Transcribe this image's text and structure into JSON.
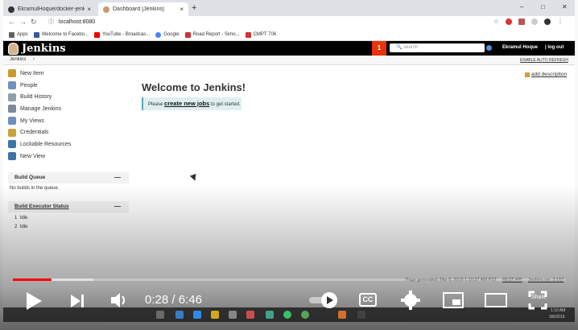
{
  "browser": {
    "tabs": [
      {
        "title": "EkramulHoque/docker-jenkins-..."
      },
      {
        "title": "Dashboard [Jenkins]"
      }
    ],
    "new_tab": "+",
    "url": "localhost:8080",
    "bookmarks": [
      "Apps",
      "Welcome to Facebo...",
      "YouTube - Broadcas...",
      "Google",
      "Road Report - Simo...",
      "CMPT 706"
    ]
  },
  "jenkins": {
    "logo": "Jenkins",
    "notification_count": "1",
    "search_placeholder": "search",
    "user": "Ekramul Hoque",
    "logout": "| log out",
    "breadcrumb": [
      "Jenkins",
      "›"
    ],
    "auto_refresh": "ENABLE AUTO REFRESH",
    "side_menu": [
      {
        "label": "New Item",
        "color": "#c89b2c"
      },
      {
        "label": "People",
        "color": "#6f8fbf"
      },
      {
        "label": "Build History",
        "color": "#8ea0a8"
      },
      {
        "label": "Manage Jenkins",
        "color": "#7a8a99"
      },
      {
        "label": "My Views",
        "color": "#6f8fbf"
      },
      {
        "label": "Credentials",
        "color": "#c8a23a"
      },
      {
        "label": "Lockable Resources",
        "color": "#3a73a8"
      },
      {
        "label": "New View",
        "color": "#3a73a8"
      }
    ],
    "build_queue": {
      "title": "Build Queue",
      "toggle": "—",
      "empty_text": "No builds in the queue."
    },
    "executor_status": {
      "title": "Build Executor Status",
      "toggle": "—",
      "rows": [
        {
          "num": "1",
          "state": "Idle"
        },
        {
          "num": "2",
          "state": "Idle"
        }
      ]
    },
    "welcome_title": "Welcome to Jenkins!",
    "notice_prefix": "Please",
    "notice_link": "create new jobs",
    "notice_suffix": "to get started.",
    "add_description": "add description",
    "footer": {
      "generated": "Page generated: Mar 8, 2019 1:10:37 AM PST",
      "rest_api": "REST API",
      "version": "Jenkins ver. 2.167"
    }
  },
  "player": {
    "current_time": "0:28",
    "separator": "/",
    "duration": "6:46",
    "progress_played_fraction": 0.07,
    "cc_label": "CC",
    "share_label": "Share"
  },
  "taskbar": {
    "date": "3/8/2019",
    "time": "1:10 AM"
  },
  "colors": {
    "jenkins_header": "#000000",
    "notification": "#e8340c",
    "progress_played": "#ff0000"
  }
}
